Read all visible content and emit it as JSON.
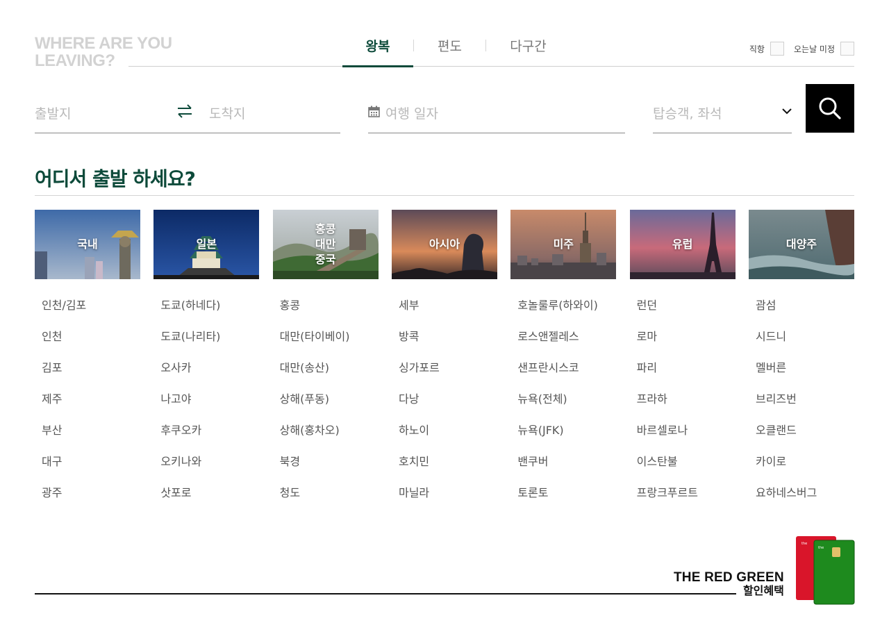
{
  "header": {
    "title": "WHERE ARE YOU\nLEAVING?",
    "tabs": [
      "왕복",
      "편도",
      "다구간"
    ],
    "options": [
      "직항",
      "오는날 미정"
    ]
  },
  "search": {
    "origin_placeholder": "출발지",
    "destination_placeholder": "도착지",
    "date_placeholder": "여행 일자",
    "passenger_placeholder": "탑승객, 좌석"
  },
  "section": {
    "title": "어디서 출발 하세요?"
  },
  "regions": [
    {
      "label": "국내",
      "cities": [
        "인천/김포",
        "인천",
        "김포",
        "제주",
        "부산",
        "대구",
        "광주"
      ]
    },
    {
      "label": "일본",
      "cities": [
        "도쿄(하네다)",
        "도쿄(나리타)",
        "오사카",
        "나고야",
        "후쿠오카",
        "오키나와",
        "삿포로"
      ]
    },
    {
      "label": "홍콩\n대만\n중국",
      "cities": [
        "홍콩",
        "대만(타이베이)",
        "대만(송산)",
        "상해(푸동)",
        "상해(홍차오)",
        "북경",
        "청도"
      ]
    },
    {
      "label": "아시아",
      "cities": [
        "세부",
        "방콕",
        "싱가포르",
        "다낭",
        "하노이",
        "호치민",
        "마닐라"
      ]
    },
    {
      "label": "미주",
      "cities": [
        "호놀룰루(하와이)",
        "로스앤젤레스",
        "샌프란시스코",
        "뉴욕(전체)",
        "뉴욕(JFK)",
        "밴쿠버",
        "토론토"
      ]
    },
    {
      "label": "유럽",
      "cities": [
        "런던",
        "로마",
        "파리",
        "프라하",
        "바르셀로나",
        "이스탄불",
        "프랑크푸르트"
      ]
    },
    {
      "label": "대양주",
      "cities": [
        "괌섬",
        "시드니",
        "멜버른",
        "브리즈번",
        "오클랜드",
        "카이로",
        "요하네스버그"
      ]
    }
  ],
  "promo": {
    "line1": "THE RED GREEN",
    "line2": "할인혜택"
  },
  "colors": {
    "accent": "#0d4a3a",
    "placeholder": "#b8b8b8",
    "search_button": "#000000"
  }
}
